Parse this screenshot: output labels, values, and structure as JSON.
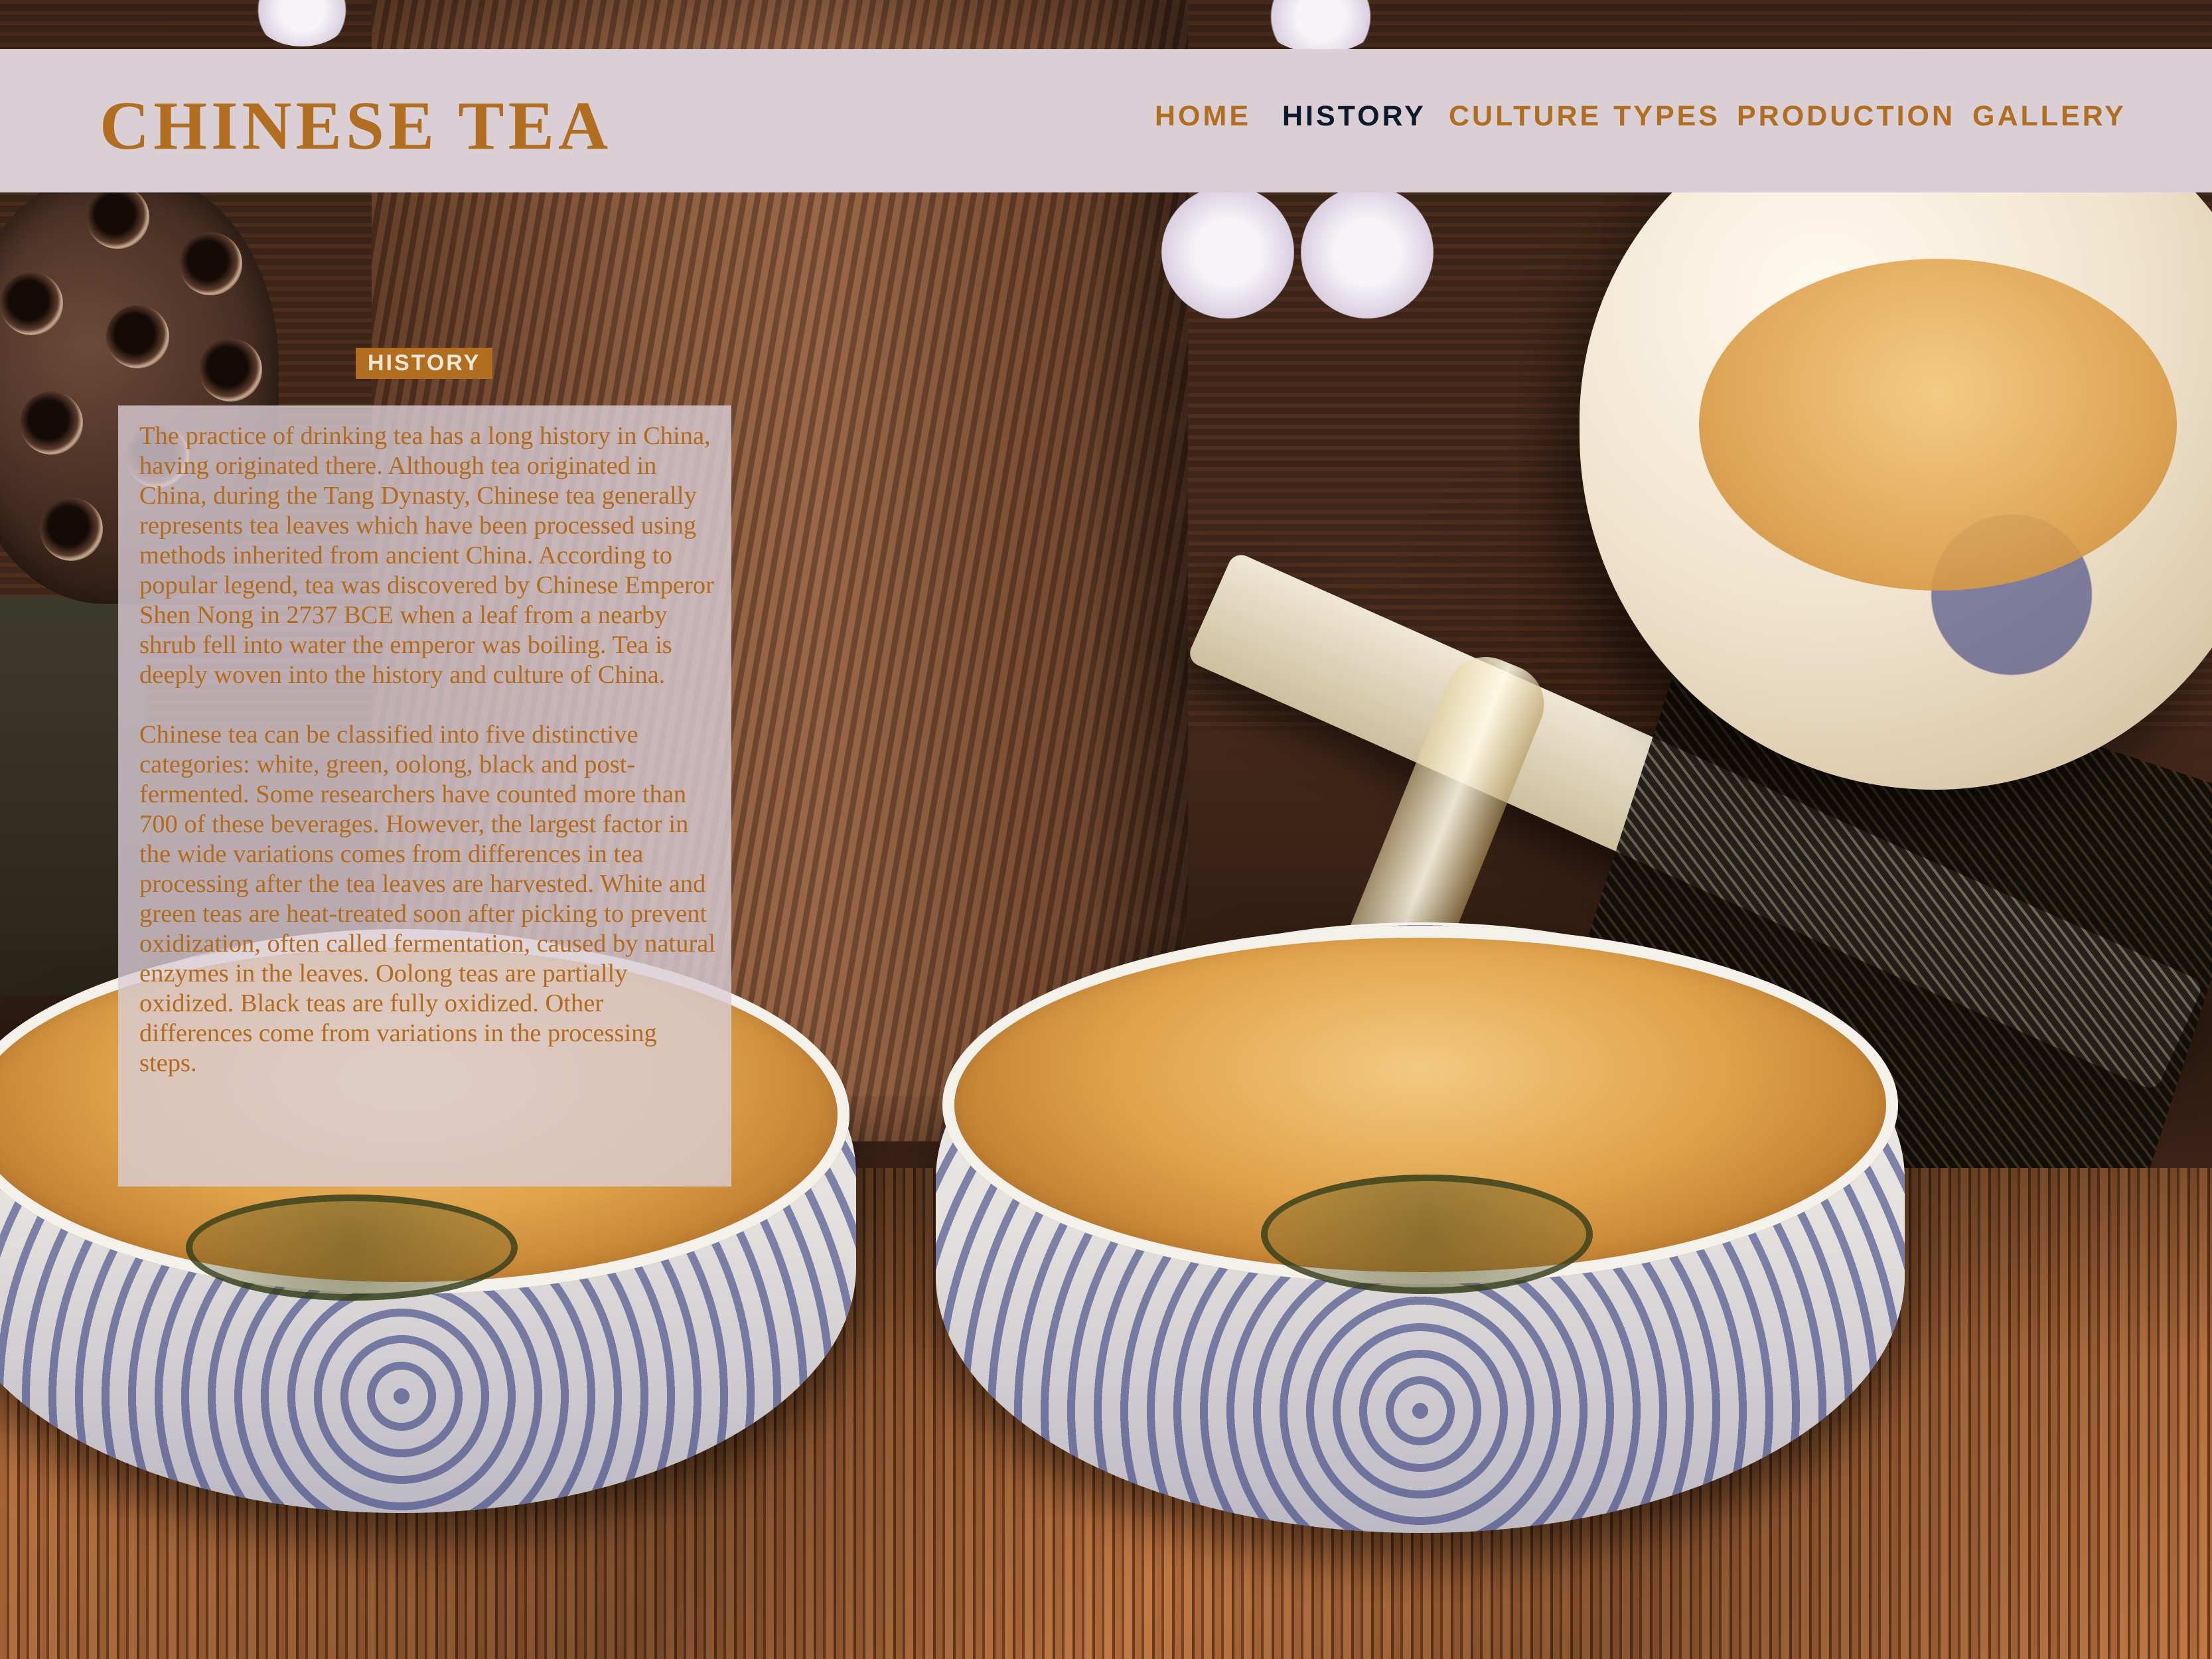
{
  "site": {
    "title": "CHINESE TEA"
  },
  "nav": {
    "items": [
      {
        "label": "HOME"
      },
      {
        "label": "HISTORY"
      },
      {
        "label": "CULTURE"
      },
      {
        "label": "TYPES"
      },
      {
        "label": "PRODUCTION"
      },
      {
        "label": "GALLERY"
      }
    ],
    "active": "HISTORY"
  },
  "section": {
    "badge": "HISTORY",
    "paragraphs": [
      "The practice of drinking tea has a long history in China, having originated there. Although tea originated in China, during the Tang Dynasty, Chinese tea generally represents tea leaves which have been processed using methods inherited from ancient China. According to popular legend, tea was discovered by Chinese Emperor Shen Nong in 2737 BCE when a leaf from a nearby shrub fell into water the emperor was boiling. Tea is deeply woven into the history and culture of China.",
      "Chinese tea can be classified into five distinctive categories: white, green, oolong, black and post-fermented. Some researchers have counted more than 700 of these beverages. However, the largest factor in the wide variations comes from differences in tea processing after the tea leaves are harvested. White and green teas are heat-treated soon after picking to prevent oxidization, often called fermentation, caused by natural enzymes in the leaves. Oolong teas are partially oxidized. Black teas are fully oxidized. Other differences come from variations in the processing steps."
    ]
  },
  "colors": {
    "accent": "#b16e21",
    "header_bg": "#d9cfd4",
    "nav_active": "#0e1a2c",
    "panel_bg": "#dacdd6"
  }
}
